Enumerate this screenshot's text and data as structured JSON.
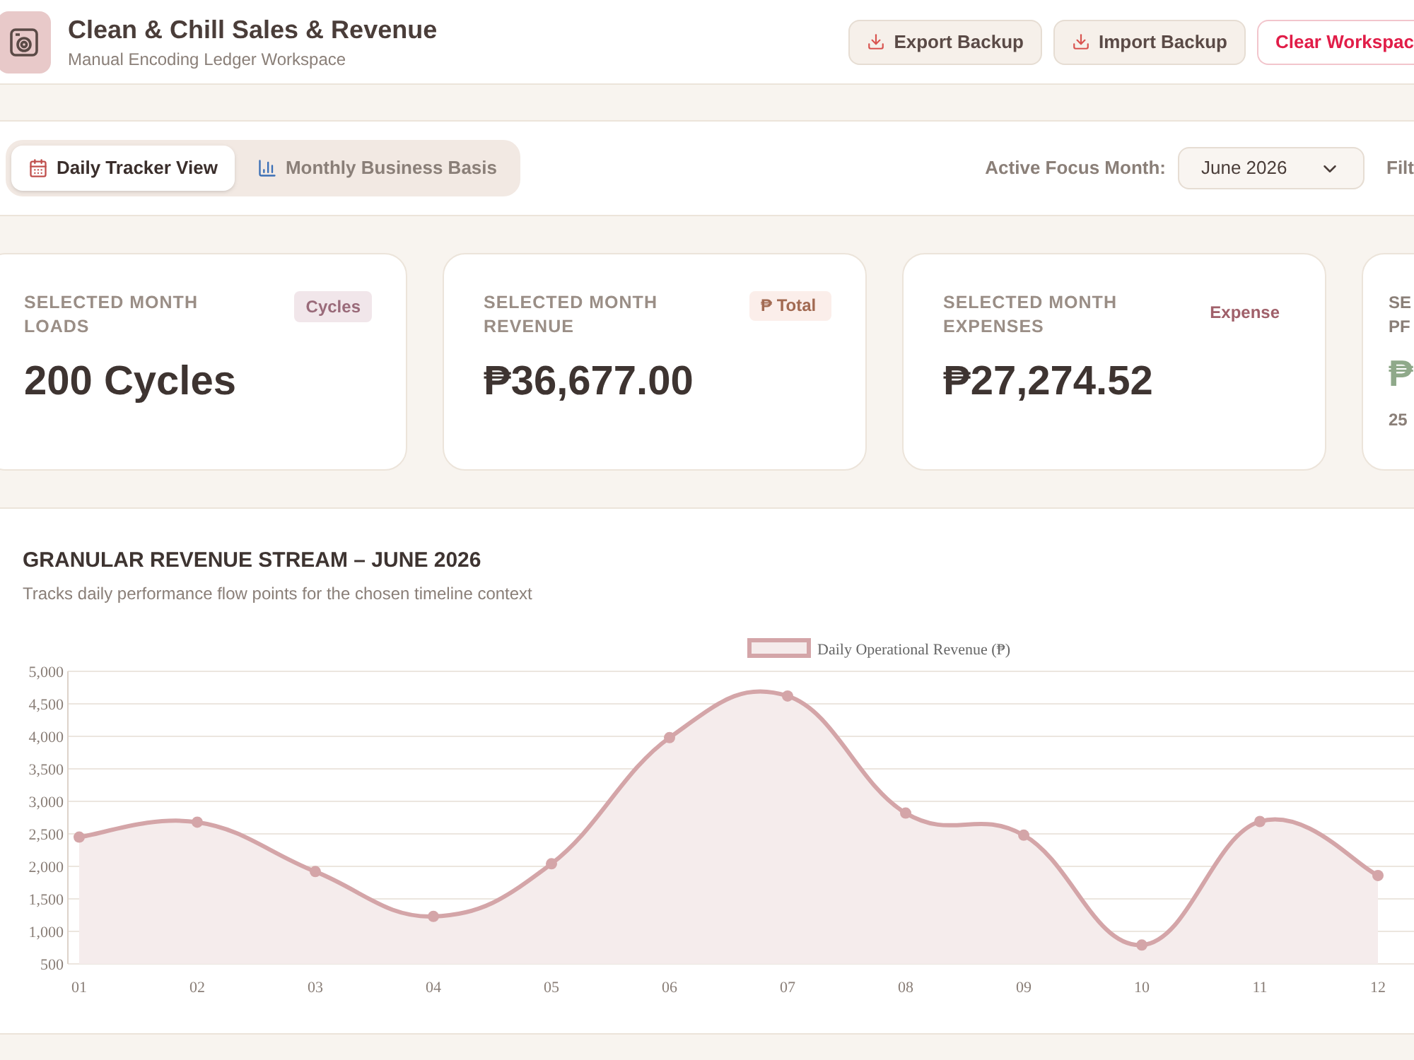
{
  "header": {
    "title": "Clean & Chill Sales & Revenue",
    "subtitle": "Manual Encoding Ledger Workspace",
    "buttons": [
      {
        "label": "Export Backup",
        "kind": "backup"
      },
      {
        "label": "Import Backup",
        "kind": "backup"
      },
      {
        "label": "Clear Workspac",
        "kind": "danger"
      }
    ]
  },
  "view_tabs": [
    {
      "label": "Daily Tracker View",
      "kind": "calendar",
      "selected": true
    },
    {
      "label": "Monthly Business Basis",
      "kind": "chart",
      "selected": false
    }
  ],
  "focus_month": {
    "label": "Active Focus Month:",
    "value": "June 2026"
  },
  "filter_label": "Filt",
  "stat_cards": [
    {
      "kind": "summary",
      "title": "SELECTED MONTH LOADS",
      "badge": {
        "label": "Cycles",
        "kind": "soft"
      },
      "value": "200 Cycles"
    },
    {
      "kind": "summary",
      "title": "SELECTED MONTH REVENUE",
      "badge": {
        "label": "₱ Total",
        "kind": "warm"
      },
      "value": "₱36,677.00"
    },
    {
      "kind": "summary",
      "title": "SELECTED MONTH EXPENSES",
      "badge": {
        "label": "Expense",
        "kind": "text"
      },
      "value": "₱27,274.52"
    },
    {
      "kind": "profit",
      "title": "SE PF",
      "value": "₱",
      "note": "25"
    }
  ],
  "revenue_panel": {
    "title": "GRANULAR REVENUE STREAM – JUNE 2026",
    "subtitle": "Tracks daily performance flow points for the chosen timeline context",
    "chart_data": {
      "type": "area",
      "categories": [
        "01",
        "02",
        "03",
        "04",
        "05",
        "06",
        "07",
        "08",
        "09",
        "10",
        "11",
        "12"
      ],
      "series": [
        {
          "name": "Daily Operational Revenue (₱)",
          "color": "#d4a5a8",
          "values": [
            2450,
            2680,
            1920,
            1230,
            2040,
            3980,
            4620,
            2820,
            2480,
            790,
            2690,
            1860
          ]
        }
      ],
      "ylim": [
        500,
        5000
      ],
      "grid": true,
      "yticks": [
        {
          "value": 500,
          "label": "500"
        },
        {
          "value": 1000,
          "label": "1,000"
        },
        {
          "value": 1500,
          "label": "1,500"
        },
        {
          "value": 2000,
          "label": "2,000"
        },
        {
          "value": 2500,
          "label": "2,500"
        },
        {
          "value": 3000,
          "label": "3,000"
        },
        {
          "value": 3500,
          "label": "3,500"
        },
        {
          "value": 4000,
          "label": "4,000"
        },
        {
          "value": 4500,
          "label": "4,500"
        },
        {
          "value": 5000,
          "label": "5,000"
        }
      ]
    }
  }
}
